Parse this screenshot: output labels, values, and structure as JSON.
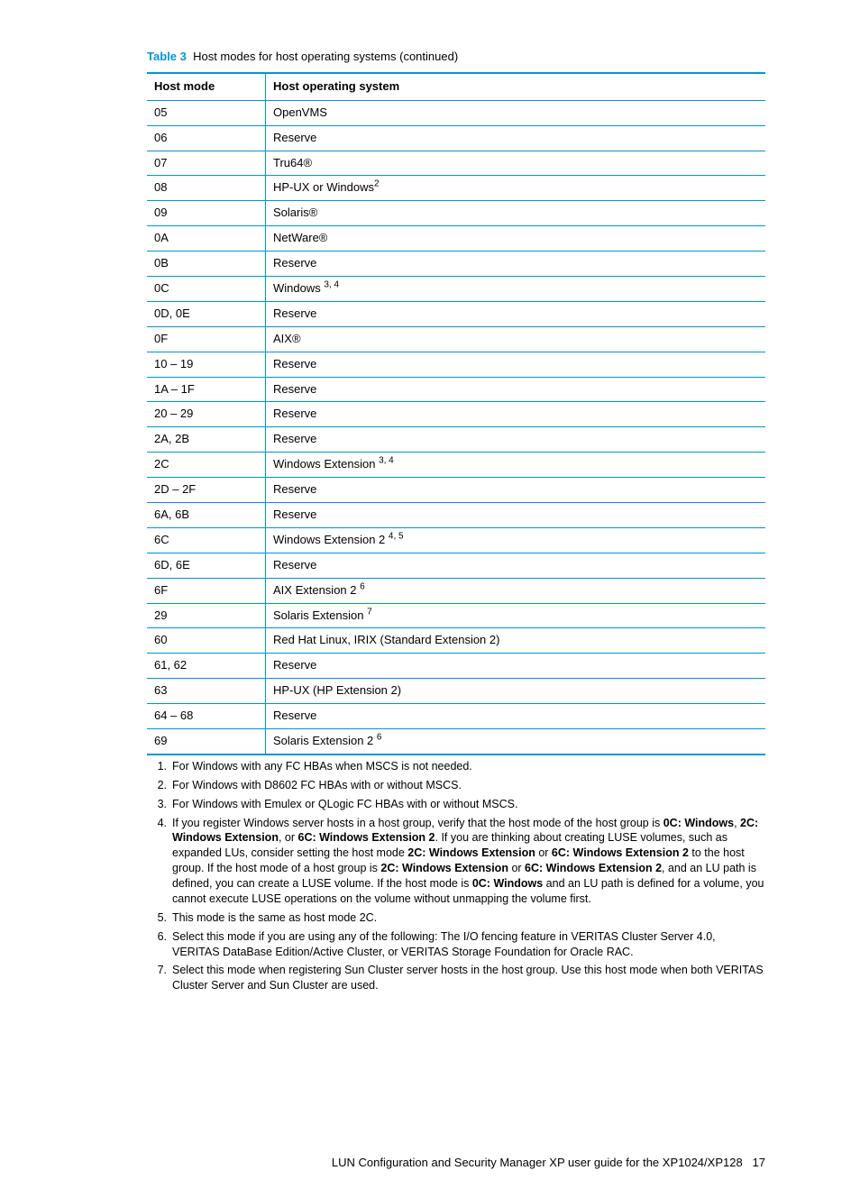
{
  "caption": {
    "label": "Table 3",
    "text": "Host modes for host operating systems (continued)"
  },
  "columns": [
    "Host mode",
    "Host operating system"
  ],
  "rows": [
    {
      "mode": "05",
      "os": "OpenVMS",
      "sup": ""
    },
    {
      "mode": "06",
      "os": "Reserve",
      "sup": ""
    },
    {
      "mode": "07",
      "os": "Tru64®",
      "sup": ""
    },
    {
      "mode": "08",
      "os": "HP-UX or Windows",
      "sup": "2"
    },
    {
      "mode": "09",
      "os": "Solaris®",
      "sup": ""
    },
    {
      "mode": "0A",
      "os": "NetWare®",
      "sup": ""
    },
    {
      "mode": "0B",
      "os": "Reserve",
      "sup": ""
    },
    {
      "mode": "0C",
      "os": "Windows ",
      "sup": "3, 4"
    },
    {
      "mode": "0D, 0E",
      "os": "Reserve",
      "sup": ""
    },
    {
      "mode": "0F",
      "os": "AIX®",
      "sup": ""
    },
    {
      "mode": "10 – 19",
      "os": "Reserve",
      "sup": ""
    },
    {
      "mode": "1A – 1F",
      "os": "Reserve",
      "sup": ""
    },
    {
      "mode": "20 – 29",
      "os": "Reserve",
      "sup": ""
    },
    {
      "mode": "2A, 2B",
      "os": "Reserve",
      "sup": ""
    },
    {
      "mode": "2C",
      "os": "Windows Extension ",
      "sup": "3, 4"
    },
    {
      "mode": "2D – 2F",
      "os": "Reserve",
      "sup": ""
    },
    {
      "mode": "6A, 6B",
      "os": "Reserve",
      "sup": ""
    },
    {
      "mode": "6C",
      "os": "Windows Extension 2 ",
      "sup": "4, 5"
    },
    {
      "mode": "6D, 6E",
      "os": "Reserve",
      "sup": ""
    },
    {
      "mode": "6F",
      "os": "AIX Extension 2 ",
      "sup": "6"
    },
    {
      "mode": "29",
      "os": "Solaris Extension ",
      "sup": "7"
    },
    {
      "mode": "60",
      "os": "Red Hat Linux, IRIX (Standard Extension 2)",
      "sup": ""
    },
    {
      "mode": "61, 62",
      "os": "Reserve",
      "sup": ""
    },
    {
      "mode": "63",
      "os": "HP-UX (HP Extension 2)",
      "sup": ""
    },
    {
      "mode": "64 – 68",
      "os": "Reserve",
      "sup": ""
    },
    {
      "mode": "69",
      "os": "Solaris Extension 2 ",
      "sup": "6"
    }
  ],
  "footnotes": [
    {
      "n": "1.",
      "html": "For Windows with any FC HBAs when MSCS is not needed."
    },
    {
      "n": "2.",
      "html": "For Windows with D8602 FC HBAs with or without MSCS."
    },
    {
      "n": "3.",
      "html": "For Windows with Emulex or QLogic FC HBAs with or without MSCS."
    },
    {
      "n": "4.",
      "html": "If you register Windows server hosts in a host group, verify that the host mode of the host group is <b>0C: Windows</b>, <b>2C: Windows Extension</b>, or <b>6C: Windows Extension 2</b>. If you are thinking about creating LUSE volumes, such as expanded LUs, consider setting the host mode <b>2C: Windows Extension</b> or <b>6C: Windows Extension 2</b> to the host group. If the host mode of a host group is <b>2C: Windows Extension</b> or <b>6C: Windows Extension 2</b>, and an LU path is defined, you can create a LUSE volume. If the host mode is <b>0C: Windows</b> and an LU path is defined for a volume, you cannot execute LUSE operations on the volume without unmapping the volume first."
    },
    {
      "n": "5.",
      "html": "This mode is the same as host mode 2C."
    },
    {
      "n": "6.",
      "html": "Select this mode if you are using any of the following: The I/O fencing feature in VERITAS Cluster Server 4.0, VERITAS DataBase Edition/Active Cluster, or VERITAS Storage Foundation for Oracle RAC."
    },
    {
      "n": "7.",
      "html": "Select this mode when registering Sun Cluster server hosts in the host group. Use this host mode when both VERITAS Cluster Server and Sun Cluster are used."
    }
  ],
  "footer": {
    "text": "LUN Configuration and Security Manager XP user guide for the XP1024/XP128",
    "page": "17"
  }
}
